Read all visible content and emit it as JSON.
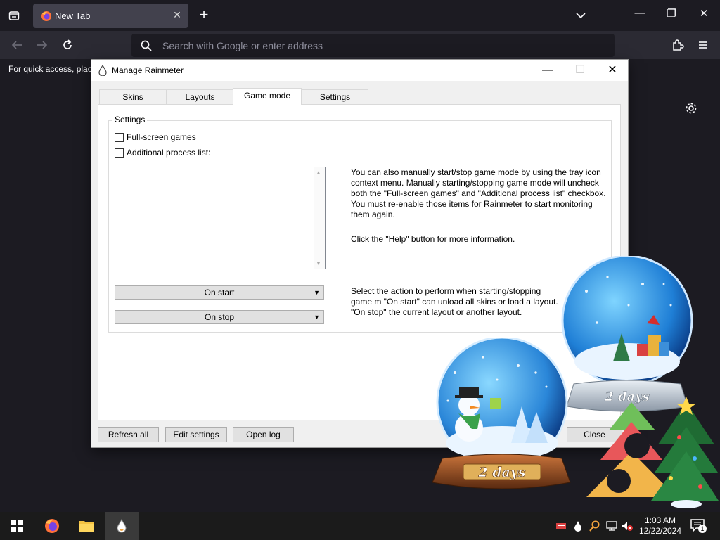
{
  "browser": {
    "tab_title": "New Tab",
    "tab_close": "✕",
    "new_tab": "+",
    "search_placeholder": "Search with Google or enter address",
    "bookmarks_hint": "For quick access, plac",
    "window_controls": {
      "minimize": "—",
      "maximize": "❐",
      "close": "✕"
    }
  },
  "dialog": {
    "title": "Manage Rainmeter",
    "controls": {
      "minimize": "—",
      "maximize": "☐",
      "close": "✕"
    },
    "tabs": [
      {
        "label": "Skins"
      },
      {
        "label": "Layouts"
      },
      {
        "label": "Game mode"
      },
      {
        "label": "Settings"
      }
    ],
    "active_tab": "Game mode",
    "group_label": "Settings",
    "checkbox_fullscreen": "Full-screen games",
    "checkbox_process": "Additional process list:",
    "info_text_1": "You can also manually start/stop game mode by using the tray icon context menu. Manually starting/stopping game mode will uncheck both the \"Full-screen games\" and \"Additional process list\" checkbox. You must re-enable those items for Rainmeter to start monitoring them again.",
    "info_text_2": "Click the \"Help\" button for more information.",
    "info_text_3": "Select the action to perform when starting/stopping game m \"On start\" can unload all skins or load a layout. \"On stop\" the current layout or another layout.",
    "on_start": "On start",
    "on_stop": "On stop",
    "buttons": {
      "refresh_all": "Refresh all",
      "edit_settings": "Edit settings",
      "open_log": "Open log",
      "close": "Close"
    }
  },
  "widgets": {
    "globe_left_label": "2 days",
    "globe_right_label": "2 days"
  },
  "taskbar": {
    "time": "1:03 AM",
    "date": "12/22/2024",
    "notification_count": "1"
  }
}
